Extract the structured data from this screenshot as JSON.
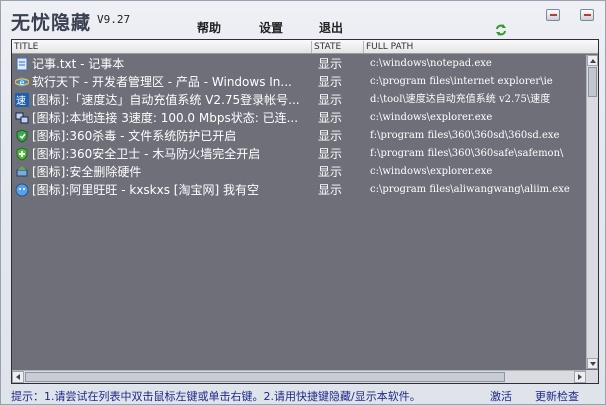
{
  "app": {
    "title": "无忧隐藏",
    "version": "V9.27"
  },
  "menu": {
    "help": "帮助",
    "settings": "设置",
    "exit": "退出"
  },
  "columns": {
    "title": "TITLE",
    "state": "STATE",
    "path": "FULL PATH"
  },
  "rows": [
    {
      "icon": "notepad-icon",
      "title": "记事.txt - 记事本",
      "state": "显示",
      "path": "c:\\windows\\notepad.exe"
    },
    {
      "icon": "internet-explorer-icon",
      "title": "软行天下 - 开发者管理区 - 产品 - Windows In...",
      "state": "显示",
      "path": "c:\\program files\\internet explorer\\ie"
    },
    {
      "icon": "speed-app-icon",
      "title": "[图标]:「速度达」自动充值系统 V2.75登录帐号...",
      "state": "显示",
      "path": "d:\\tool\\速度达自动充值系统 v2.75\\速度"
    },
    {
      "icon": "network-icon",
      "title": "[图标]:本地连接 3速度: 100.0 Mbps状态: 已连...",
      "state": "显示",
      "path": "c:\\windows\\explorer.exe"
    },
    {
      "icon": "360-antivirus-icon",
      "title": "[图标]:360杀毒 - 文件系统防护已开启",
      "state": "显示",
      "path": "f:\\program files\\360\\360sd\\360sd.exe"
    },
    {
      "icon": "360-safe-icon",
      "title": "[图标]:360安全卫士 - 木马防火墙完全开启",
      "state": "显示",
      "path": "f:\\program files\\360\\360safe\\safemon\\"
    },
    {
      "icon": "safe-remove-hardware-icon",
      "title": "[图标]:安全删除硬件",
      "state": "显示",
      "path": "c:\\windows\\explorer.exe"
    },
    {
      "icon": "aliwangwang-icon",
      "title": "[图标]:阿里旺旺 - kxskxs [淘宝网] 我有空",
      "state": "显示",
      "path": "c:\\program files\\aliwangwang\\aliim.exe"
    }
  ],
  "status": {
    "tip": "提示：1.请尝试在列表中双击鼠标左键或单击右键。2.请用快捷键隐藏/显示本软件。",
    "activate": "激活",
    "update": "更新检查"
  },
  "colors": {
    "list_background": "#6f6f7a",
    "row_text": "#ffffff",
    "status_text": "#1e2a8a"
  }
}
